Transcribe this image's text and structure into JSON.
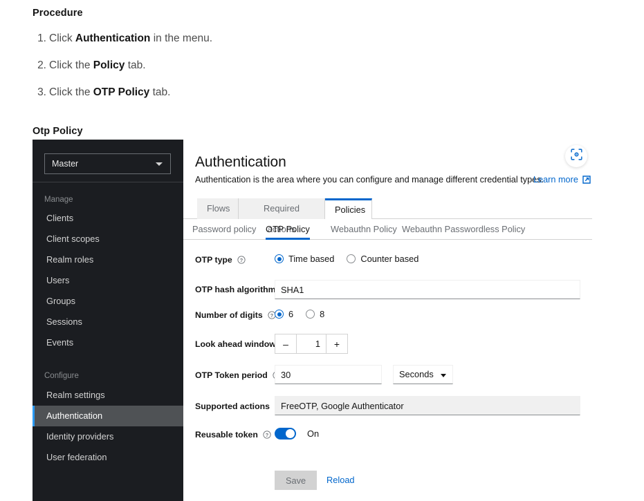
{
  "document": {
    "procedure_heading": "Procedure",
    "steps": [
      {
        "num": "1.",
        "pre": "Click ",
        "bold": "Authentication",
        "post": " in the menu."
      },
      {
        "num": "2.",
        "pre": "Click the ",
        "bold": "Policy",
        "post": " tab."
      },
      {
        "num": "3.",
        "pre": "Click the ",
        "bold": "OTP Policy",
        "post": " tab."
      }
    ],
    "figure_heading": "Otp Policy"
  },
  "app": {
    "sidebar": {
      "realm_selector": {
        "value": "Master",
        "icon": "chevron-down-icon"
      },
      "groups": [
        {
          "label": "Manage",
          "items": [
            {
              "label": "Clients",
              "active": false
            },
            {
              "label": "Client scopes",
              "active": false
            },
            {
              "label": "Realm roles",
              "active": false
            },
            {
              "label": "Users",
              "active": false
            },
            {
              "label": "Groups",
              "active": false
            },
            {
              "label": "Sessions",
              "active": false
            },
            {
              "label": "Events",
              "active": false
            }
          ]
        },
        {
          "label": "Configure",
          "items": [
            {
              "label": "Realm settings",
              "active": false
            },
            {
              "label": "Authentication",
              "active": true
            },
            {
              "label": "Identity providers",
              "active": false
            },
            {
              "label": "User federation",
              "active": false
            }
          ]
        }
      ]
    },
    "header": {
      "title": "Authentication",
      "description": "Authentication is the area where you can configure and manage different credential types.",
      "learn_more": "Learn more",
      "learn_more_icon": "external-link-icon",
      "scan_button_icon": "scan-code-icon"
    },
    "tabs": [
      {
        "label": "Flows",
        "active": false
      },
      {
        "label": "Required actions",
        "active": false
      },
      {
        "label": "Policies",
        "active": true
      }
    ],
    "subtabs": [
      {
        "label": "Password policy",
        "active": false
      },
      {
        "label": "OTP Policy",
        "active": true
      },
      {
        "label": "Webauthn Policy",
        "active": false
      },
      {
        "label": "Webauthn Passwordless Policy",
        "active": false
      }
    ],
    "form": {
      "otp_type": {
        "label": "OTP type",
        "help_icon": "help-circle-icon",
        "options": [
          {
            "label": "Time based",
            "selected": true
          },
          {
            "label": "Counter based",
            "selected": false
          }
        ]
      },
      "otp_hash_algorithm": {
        "label": "OTP hash algorithm",
        "help_icon": "help-circle-icon",
        "value": "SHA1",
        "placeholder": ""
      },
      "number_of_digits": {
        "label": "Number of digits",
        "help_icon": "help-circle-icon",
        "options": [
          {
            "label": "6",
            "selected": true
          },
          {
            "label": "8",
            "selected": false
          }
        ]
      },
      "look_ahead_window": {
        "label": "Look ahead window",
        "help_icon": "help-circle-icon",
        "minus": "–",
        "value": "1",
        "plus": "+"
      },
      "otp_token_period": {
        "label": "OTP Token period",
        "help_icon": "help-circle-icon",
        "value": "30",
        "unit": "Seconds",
        "unit_icon": "chevron-down-icon"
      },
      "supported_actions": {
        "label": "Supported actions",
        "help_icon": "help-circle-icon",
        "value": "FreeOTP, Google Authenticator"
      },
      "reusable_token": {
        "label": "Reusable token",
        "help_icon": "help-circle-icon",
        "state": "On",
        "enabled": true
      },
      "actions": {
        "save": "Save",
        "reload": "Reload"
      }
    }
  },
  "colors": {
    "accent_blue": "#0066cc",
    "sidebar_bg": "#1b1d21",
    "sidebar_active_bg": "#4f5255",
    "sidebar_active_border": "#2b9af3",
    "toggle_on": "#0066cc",
    "tab_inactive_bg": "#f0f0f0",
    "disabled_input_bg": "#f0f0f0",
    "save_disabled_bg": "#d2d2d2"
  }
}
